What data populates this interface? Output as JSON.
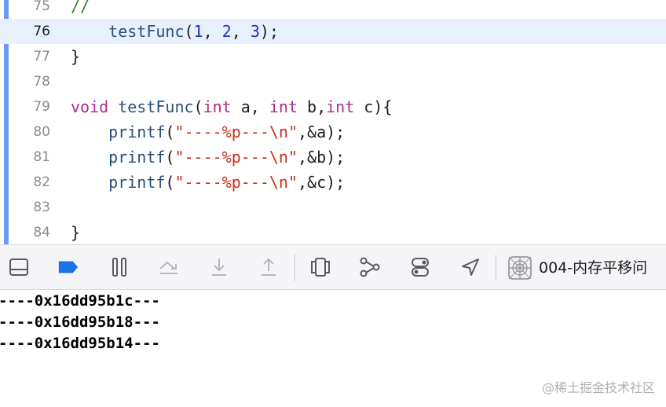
{
  "editor": {
    "lines": [
      {
        "num": "75",
        "tokens": [
          {
            "t": "//",
            "c": "cm"
          }
        ]
      },
      {
        "num": "76",
        "current": true,
        "tokens": [
          {
            "t": "    "
          },
          {
            "t": "testFunc",
            "c": "fn"
          },
          {
            "t": "("
          },
          {
            "t": "1",
            "c": "num"
          },
          {
            "t": ", "
          },
          {
            "t": "2",
            "c": "num"
          },
          {
            "t": ", "
          },
          {
            "t": "3",
            "c": "num"
          },
          {
            "t": ");"
          }
        ]
      },
      {
        "num": "77",
        "tokens": [
          {
            "t": "}"
          }
        ]
      },
      {
        "num": "78",
        "tokens": []
      },
      {
        "num": "79",
        "tokens": [
          {
            "t": "void",
            "c": "kw"
          },
          {
            "t": " "
          },
          {
            "t": "testFunc",
            "c": "fn"
          },
          {
            "t": "("
          },
          {
            "t": "int",
            "c": "kw"
          },
          {
            "t": " a, "
          },
          {
            "t": "int",
            "c": "kw"
          },
          {
            "t": " b,"
          },
          {
            "t": "int",
            "c": "kw"
          },
          {
            "t": " c){"
          }
        ]
      },
      {
        "num": "80",
        "tokens": [
          {
            "t": "    "
          },
          {
            "t": "printf",
            "c": "fn"
          },
          {
            "t": "("
          },
          {
            "t": "\"----%p---\\n\"",
            "c": "str"
          },
          {
            "t": ",&a);"
          }
        ]
      },
      {
        "num": "81",
        "tokens": [
          {
            "t": "    "
          },
          {
            "t": "printf",
            "c": "fn"
          },
          {
            "t": "("
          },
          {
            "t": "\"----%p---\\n\"",
            "c": "str"
          },
          {
            "t": ",&b);"
          }
        ]
      },
      {
        "num": "82",
        "tokens": [
          {
            "t": "    "
          },
          {
            "t": "printf",
            "c": "fn"
          },
          {
            "t": "("
          },
          {
            "t": "\"----%p---\\n\"",
            "c": "str"
          },
          {
            "t": ",&c);"
          }
        ]
      },
      {
        "num": "83",
        "tokens": []
      },
      {
        "num": "84",
        "tokens": [
          {
            "t": "}"
          }
        ]
      }
    ]
  },
  "toolbar": {
    "target_label": "004-内存平移问",
    "icons": [
      "hide-debug-area-icon",
      "breakpoints-toggle-icon",
      "pause-icon",
      "step-over-icon",
      "step-into-icon",
      "step-out-icon",
      "view-hierarchy-icon",
      "memory-graph-icon",
      "environment-overrides-icon",
      "simulate-location-icon",
      "target-app-icon"
    ]
  },
  "console": {
    "lines": [
      "----0x16dd95b1c---",
      "----0x16dd95b18---",
      "----0x16dd95b14---"
    ]
  },
  "watermark": "@稀土掘金技术社区",
  "colors": {
    "keyword": "#b02a8c",
    "function": "#28507a",
    "number": "#1e34b8",
    "string": "#c8321a",
    "comment": "#2e7d32",
    "current_line": "#e8f0fc",
    "breakpoint_accent": "#1a73e8"
  }
}
